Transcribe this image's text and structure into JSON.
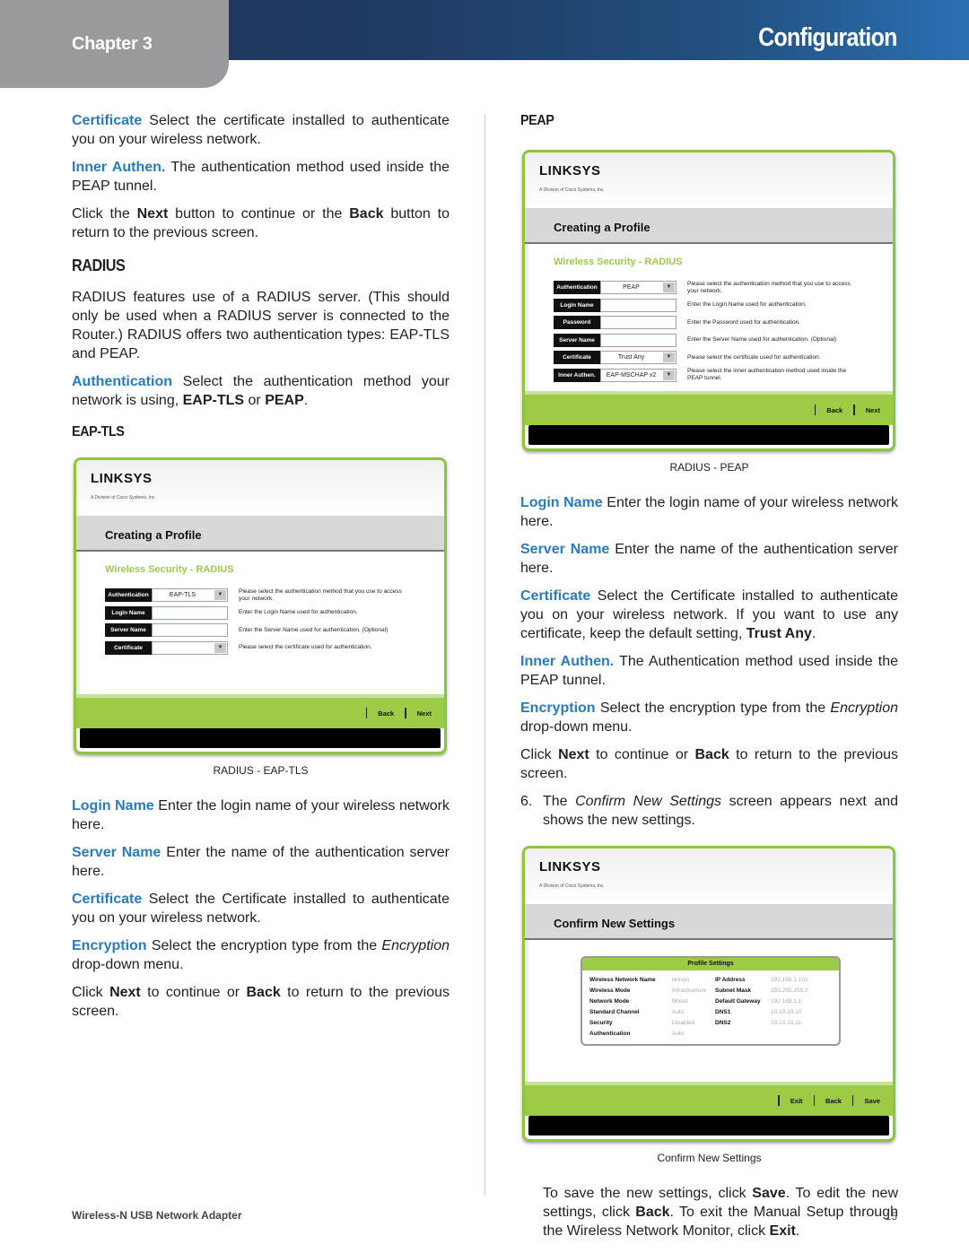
{
  "header": {
    "chapter": "Chapter 3",
    "title": "Configuration"
  },
  "left": {
    "p1_term": "Certificate",
    "p1_text": "  Select the certificate installed to authenticate you on your wireless network.",
    "p2_term": "Inner Authen.",
    "p2_text": " The authentication method used inside the PEAP tunnel.",
    "p3_a": "Click the ",
    "p3_b1": "Next",
    "p3_c": " button to continue or the ",
    "p3_b2": "Back",
    "p3_d": " button to return to the previous screen.",
    "radius_heading": "RADIUS",
    "radius_text": "RADIUS features use of a RADIUS server. (This should only be used when a RADIUS server is connected to the Router.) RADIUS offers two authentication types: EAP-TLS and PEAP.",
    "auth_term": "Authentication",
    "auth_a": "  Select the authentication method your network is using, ",
    "auth_b1": "EAP-TLS",
    "auth_c": " or ",
    "auth_b2": "PEAP",
    "auth_d": ".",
    "eaptls_heading": "EAP-TLS",
    "caption": "RADIUS - EAP-TLS",
    "login_term": "Login Name",
    "login_text": " Enter the login name of your wireless network here.",
    "server_term": "Server Name",
    "server_text": " Enter the name of the authentication server here.",
    "cert_term": "Certificate",
    "cert_text": "  Select the Certificate installed to authenticate you on your wireless network.",
    "enc_term": "Encryption",
    "enc_a": " Select the encryption type from the ",
    "enc_i": "Encryption",
    "enc_b": " drop-down menu.",
    "click_a": "Click ",
    "click_b1": "Next",
    "click_c": " to continue or ",
    "click_b2": "Back",
    "click_d": " to return to the previous screen."
  },
  "eaptls_shot": {
    "logo": "LINKSYS",
    "logo_sub": "A Division of Cisco Systems, Inc.",
    "title": "Creating a Profile",
    "section": "Wireless Security - RADIUS",
    "rows": [
      {
        "label": "Authentication",
        "value": "EAP-TLS",
        "dropdown": true,
        "help": "Please select the authentication method that you use to access your network."
      },
      {
        "label": "Login Name",
        "value": "",
        "dropdown": false,
        "help": "Enter the Login Name used for authentication."
      },
      {
        "label": "Server Name",
        "value": "",
        "dropdown": false,
        "help": "Enter the Server Name used for authentication. (Optional)"
      },
      {
        "label": "Certificate",
        "value": "",
        "dropdown": true,
        "help": "Please select the certificate used for authentication."
      }
    ],
    "back": "Back",
    "next": "Next"
  },
  "right": {
    "peap_heading": "PEAP",
    "caption1": "RADIUS - PEAP",
    "login_term": "Login Name",
    "login_text": " Enter the login name of your wireless network here.",
    "server_term": "Server Name",
    "server_text": " Enter the name of the authentication server here.",
    "cert_term": "Certificate",
    "cert_a": "  Select the Certificate installed to authenticate you on your wireless network.  If you want to use any certificate, keep the default setting, ",
    "cert_b": "Trust Any",
    "cert_c": ".",
    "inner_term": "Inner Authen.",
    "inner_text": " The Authentication method used inside the PEAP tunnel.",
    "enc_term": "Encryption",
    "enc_a": " Select the encryption type from the ",
    "enc_i": "Encryption",
    "enc_b": " drop-down menu.",
    "click_a": "Click ",
    "click_b1": "Next",
    "click_c": " to continue or ",
    "click_b2": "Back",
    "click_d": " to return to the previous screen.",
    "step_num": "6.",
    "step_a": "The ",
    "step_i": "Confirm New Settings",
    "step_b": " screen appears next and shows the new settings.",
    "caption2": "Confirm New Settings",
    "save_a": "To save the new settings, click ",
    "save_b1": "Save",
    "save_c": ". To edit the new settings, click ",
    "save_b2": "Back",
    "save_d": ". To exit the Manual Setup through the Wireless Network Monitor, click ",
    "save_b3": "Exit",
    "save_e": "."
  },
  "peap_shot": {
    "logo": "LINKSYS",
    "logo_sub": "A Division of Cisco Systems, Inc.",
    "title": "Creating a Profile",
    "section": "Wireless Security - RADIUS",
    "rows": [
      {
        "label": "Authentication",
        "value": "PEAP",
        "dropdown": true,
        "help": "Please select the authentication method that you use to access your network."
      },
      {
        "label": "Login Name",
        "value": "",
        "dropdown": false,
        "help": "Enter the Login Name used for authentication."
      },
      {
        "label": "Password",
        "value": "",
        "dropdown": false,
        "help": "Enter the Password used for authentication."
      },
      {
        "label": "Server Name",
        "value": "",
        "dropdown": false,
        "help": "Enter the Server Name used for authentication. (Optional)"
      },
      {
        "label": "Certificate",
        "value": "Trust Any",
        "dropdown": true,
        "help": "Please select the certificate used for authentication."
      },
      {
        "label": "Inner Authen.",
        "value": "EAP-MSCHAP v2",
        "dropdown": true,
        "help": "Please select the inner authentication method used inside the PEAP tunnel."
      }
    ],
    "back": "Back",
    "next": "Next"
  },
  "confirm_shot": {
    "logo": "LINKSYS",
    "logo_sub": "A Division of Cisco Systems, Inc.",
    "title": "Confirm New Settings",
    "profile_heading": "Profile Settings",
    "left_pairs": [
      {
        "k": "Wireless Network Name",
        "v": "linksys"
      },
      {
        "k": "Wireless Mode",
        "v": "Infrastructure"
      },
      {
        "k": "Network Mode",
        "v": "Mixed"
      },
      {
        "k": "Standard Channel",
        "v": "Auto"
      },
      {
        "k": "Security",
        "v": "Disabled"
      },
      {
        "k": "Authentication",
        "v": "Auto"
      }
    ],
    "right_pairs": [
      {
        "k": "IP Address",
        "v": "192.168.1.101"
      },
      {
        "k": "Subnet Mask",
        "v": "255.255.255.0"
      },
      {
        "k": "Default Gateway",
        "v": "192.168.1.1"
      },
      {
        "k": "DNS1",
        "v": "10.10.10.10"
      },
      {
        "k": "DNS2",
        "v": "10.10.10.11"
      }
    ],
    "exit": "Exit",
    "back": "Back",
    "save": "Save"
  },
  "footer": {
    "product": "Wireless-N USB Network Adapter",
    "page": "15"
  }
}
